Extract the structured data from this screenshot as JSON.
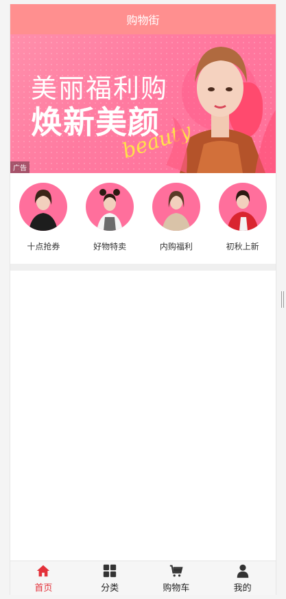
{
  "header": {
    "title": "购物街"
  },
  "banner": {
    "line1": "美丽福利购",
    "line2": "焕新美颜",
    "script": "beauty",
    "ad_tag": "广告",
    "colors": {
      "bg": "#ff7aa0",
      "script": "#ffe14a"
    }
  },
  "features": [
    {
      "label": "十点抢券",
      "icon": "model-avatar-black"
    },
    {
      "label": "好物特卖",
      "icon": "model-avatar-buns"
    },
    {
      "label": "内购福利",
      "icon": "model-avatar-beige"
    },
    {
      "label": "初秋上新",
      "icon": "model-avatar-red"
    }
  ],
  "tabbar": {
    "items": [
      {
        "label": "首页",
        "icon": "home-icon",
        "active": true
      },
      {
        "label": "分类",
        "icon": "grid-icon",
        "active": false
      },
      {
        "label": "购物车",
        "icon": "cart-icon",
        "active": false
      },
      {
        "label": "我的",
        "icon": "user-icon",
        "active": false
      }
    ],
    "active_color": "#e3313a"
  },
  "colors": {
    "navbar": "#ff8f8f",
    "accent": "#ff6f9c"
  }
}
